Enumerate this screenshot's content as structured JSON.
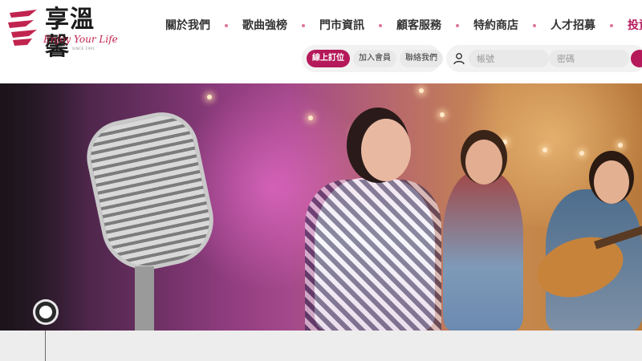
{
  "brand": {
    "name": "享溫馨",
    "tagline": "Enjoy Your Life",
    "since": "SINCE 1991",
    "accent_color": "#b5195a"
  },
  "nav": {
    "items": [
      {
        "label": "關於我們"
      },
      {
        "label": "歌曲強榜"
      },
      {
        "label": "門市資訊"
      },
      {
        "label": "顧客服務"
      },
      {
        "label": "特約商店"
      },
      {
        "label": "人才招募"
      },
      {
        "label": "投資"
      }
    ]
  },
  "actions": {
    "booking": "線上訂位",
    "join": "加入會員",
    "contact": "聯絡我們"
  },
  "login": {
    "user_icon": "user-icon",
    "account_placeholder": "帳號",
    "password_placeholder": "密碼"
  },
  "hero": {
    "image": "karaoke-singers-banner"
  }
}
